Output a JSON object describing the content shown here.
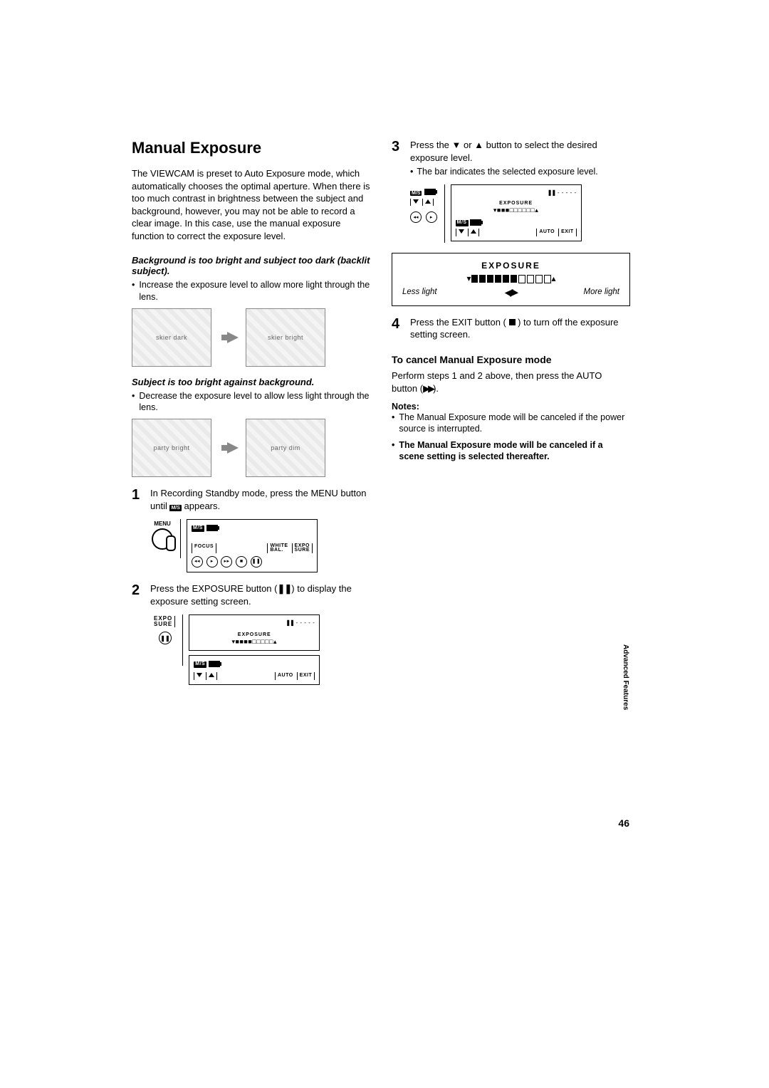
{
  "title": "Manual Exposure",
  "intro": "The VIEWCAM is preset to Auto Exposure mode, which automatically chooses the optimal aperture. When there is too much contrast in brightness between the subject and background, however, you may not be able to record a clear image. In this case, use the manual exposure function to correct the exposure level.",
  "case1_head": "Background is too bright and subject too dark (backlit subject).",
  "case1_bullet": "Increase the exposure level to allow more light through the lens.",
  "case2_head": "Subject is too bright against background.",
  "case2_bullet": "Decrease the exposure level to allow less light through the lens.",
  "step1": "In Recording Standby mode, press the MENU button until ",
  "step1_tail": " appears.",
  "step2": "Press the EXPOSURE button (",
  "step2_tail": ") to display the exposure setting screen.",
  "step3": "Press the ▼ or ▲ button to select the desired exposure level.",
  "step3_sub": "The bar indicates the selected exposure level.",
  "step4": "Press the EXIT button ( ",
  "step4_tail": " ) to turn off the exposure setting screen.",
  "cancel_head": "To cancel Manual Exposure mode",
  "cancel_body_a": "Perform steps 1 and 2 above, then press the AUTO button (",
  "cancel_body_b": ").",
  "notes_head": "Notes:",
  "note1": "The Manual Exposure mode will be canceled if the power source is interrupted.",
  "note2": "The Manual Exposure mode will be canceled if a scene setting is selected thereafter.",
  "lcd": {
    "menu": "MENU",
    "focus": "FOCUS",
    "white": "WHITE BAL.",
    "expo2": "EXPO SURE",
    "expo_short": "EXPO",
    "sure_short": "SURE",
    "exposure": "EXPOSURE",
    "auto": "AUTO",
    "exit": "EXIT",
    "ms": "M/S"
  },
  "expobox": {
    "title": "EXPOSURE",
    "less": "Less light",
    "more": "More light"
  },
  "side_tab": "Advanced Features",
  "page_num": "46"
}
